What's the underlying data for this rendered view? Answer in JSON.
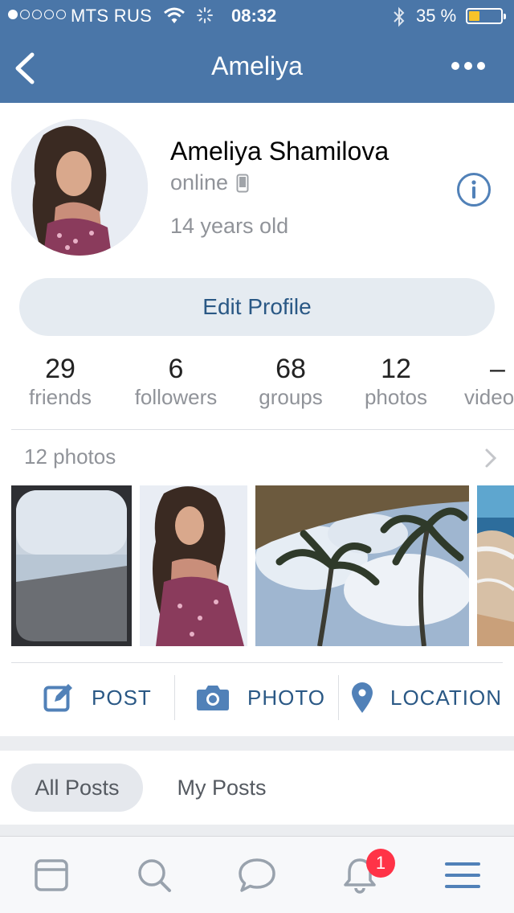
{
  "status_bar": {
    "carrier": "MTS RUS",
    "time": "08:32",
    "battery_percent": "35 %",
    "battery_level": 0.35,
    "signal_bars": 1
  },
  "nav": {
    "title": "Ameliya",
    "back_icon": "chevron-left-icon",
    "more_icon": "more-dots-icon"
  },
  "profile": {
    "full_name": "Ameliya Shamilova",
    "status": "online",
    "age": "14 years old",
    "edit_label": "Edit Profile"
  },
  "counters": [
    {
      "value": "29",
      "label": "friends"
    },
    {
      "value": "6",
      "label": "followers"
    },
    {
      "value": "68",
      "label": "groups"
    },
    {
      "value": "12",
      "label": "photos"
    },
    {
      "value": "–",
      "label": "videos"
    }
  ],
  "photos": {
    "title": "12 photos"
  },
  "actions": [
    {
      "label": "POST",
      "icon": "edit-icon"
    },
    {
      "label": "PHOTO",
      "icon": "camera-icon"
    },
    {
      "label": "LOCATION",
      "icon": "location-pin-icon"
    }
  ],
  "post_filters": [
    {
      "label": "All Posts",
      "active": true
    },
    {
      "label": "My Posts",
      "active": false
    }
  ],
  "tabbar": {
    "notifications_badge": "1",
    "tabs": [
      "news-icon",
      "search-icon",
      "messages-icon",
      "bell-icon",
      "menu-icon"
    ]
  },
  "colors": {
    "brand": "#4a76a8",
    "link": "#2a5885",
    "accent_icon": "#5181b8",
    "badge": "#ff3347"
  }
}
